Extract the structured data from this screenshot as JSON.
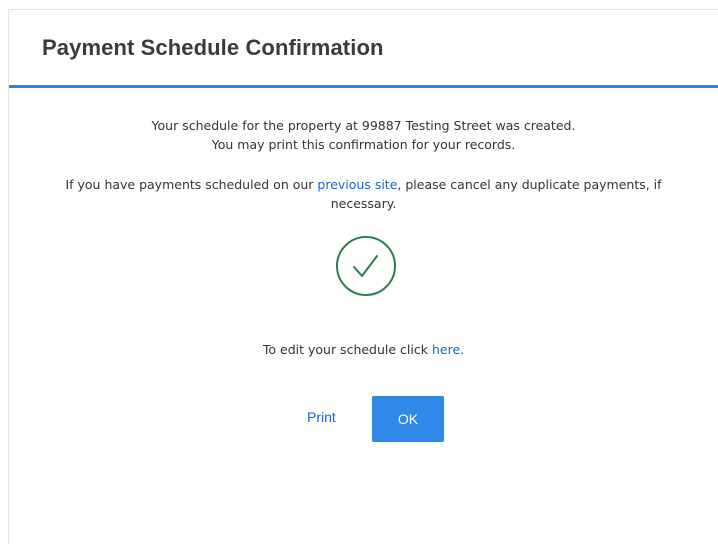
{
  "dialog": {
    "title": "Payment Schedule Confirmation"
  },
  "body": {
    "line1": "Your schedule for the property at 99887 Testing Street was created.",
    "line2": "You may print this confirmation for your records.",
    "duplicate_prefix": "If you have payments scheduled on our ",
    "duplicate_link": "previous site",
    "duplicate_suffix": ", please cancel any duplicate payments, if",
    "duplicate_line2": "necessary.",
    "edit_prefix": "To edit your schedule click ",
    "edit_link": "here."
  },
  "icons": {
    "success": "check-circle-icon",
    "success_color": "#2e7d4f"
  },
  "actions": {
    "print_label": "Print",
    "ok_label": "OK"
  },
  "colors": {
    "accent": "#2e8ad8",
    "link": "#1d65c4",
    "button": "#2e8ae6"
  }
}
